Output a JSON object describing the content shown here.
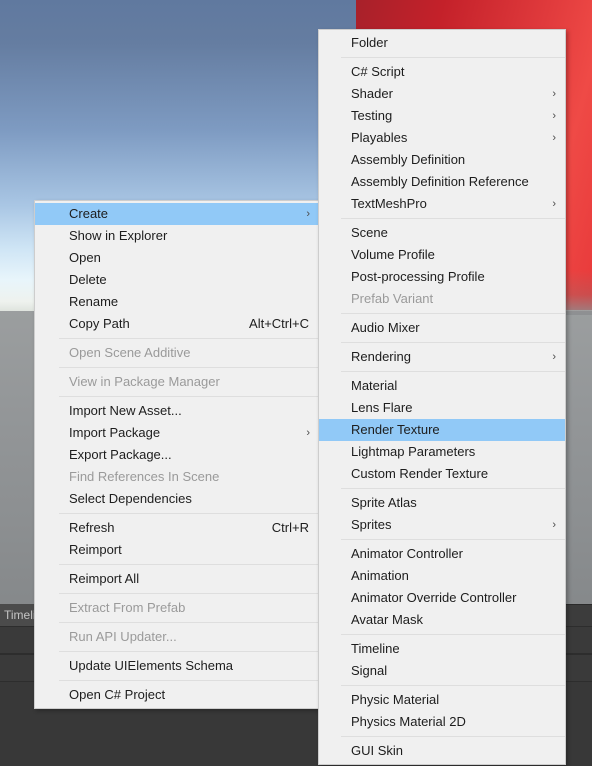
{
  "scene": {
    "sky_color_top": "#60799f",
    "sky_color_bottom": "#e8f5fb",
    "ground_color": "#939698",
    "object_color": "#e03a3c"
  },
  "editor": {
    "tab_label": "Timeline"
  },
  "context_menu": {
    "name": "project-context-menu",
    "items": [
      {
        "label": "Create",
        "selected": true,
        "submenu": true,
        "arrow": "›"
      },
      {
        "label": "Show in Explorer"
      },
      {
        "label": "Open"
      },
      {
        "label": "Delete"
      },
      {
        "label": "Rename"
      },
      {
        "label": "Copy Path",
        "shortcut": "Alt+Ctrl+C"
      },
      {
        "separator": true
      },
      {
        "label": "Open Scene Additive",
        "disabled": true
      },
      {
        "separator": true
      },
      {
        "label": "View in Package Manager",
        "disabled": true
      },
      {
        "separator": true
      },
      {
        "label": "Import New Asset..."
      },
      {
        "label": "Import Package",
        "submenu": true,
        "arrow": "›"
      },
      {
        "label": "Export Package..."
      },
      {
        "label": "Find References In Scene",
        "disabled": true
      },
      {
        "label": "Select Dependencies"
      },
      {
        "separator": true
      },
      {
        "label": "Refresh",
        "shortcut": "Ctrl+R"
      },
      {
        "label": "Reimport"
      },
      {
        "separator": true
      },
      {
        "label": "Reimport All"
      },
      {
        "separator": true
      },
      {
        "label": "Extract From Prefab",
        "disabled": true
      },
      {
        "separator": true
      },
      {
        "label": "Run API Updater...",
        "disabled": true
      },
      {
        "separator": true
      },
      {
        "label": "Update UIElements Schema"
      },
      {
        "separator": true
      },
      {
        "label": "Open C# Project"
      }
    ]
  },
  "create_submenu": {
    "name": "create-submenu",
    "items": [
      {
        "label": "Folder"
      },
      {
        "separator": true
      },
      {
        "label": "C# Script"
      },
      {
        "label": "Shader",
        "submenu": true,
        "arrow": "›"
      },
      {
        "label": "Testing",
        "submenu": true,
        "arrow": "›"
      },
      {
        "label": "Playables",
        "submenu": true,
        "arrow": "›"
      },
      {
        "label": "Assembly Definition"
      },
      {
        "label": "Assembly Definition Reference"
      },
      {
        "label": "TextMeshPro",
        "submenu": true,
        "arrow": "›"
      },
      {
        "separator": true
      },
      {
        "label": "Scene"
      },
      {
        "label": "Volume Profile"
      },
      {
        "label": "Post-processing Profile"
      },
      {
        "label": "Prefab Variant",
        "disabled": true
      },
      {
        "separator": true
      },
      {
        "label": "Audio Mixer"
      },
      {
        "separator": true
      },
      {
        "label": "Rendering",
        "submenu": true,
        "arrow": "›"
      },
      {
        "separator": true
      },
      {
        "label": "Material"
      },
      {
        "label": "Lens Flare"
      },
      {
        "label": "Render Texture",
        "selected": true
      },
      {
        "label": "Lightmap Parameters"
      },
      {
        "label": "Custom Render Texture"
      },
      {
        "separator": true
      },
      {
        "label": "Sprite Atlas"
      },
      {
        "label": "Sprites",
        "submenu": true,
        "arrow": "›"
      },
      {
        "separator": true
      },
      {
        "label": "Animator Controller"
      },
      {
        "label": "Animation"
      },
      {
        "label": "Animator Override Controller"
      },
      {
        "label": "Avatar Mask"
      },
      {
        "separator": true
      },
      {
        "label": "Timeline"
      },
      {
        "label": "Signal"
      },
      {
        "separator": true
      },
      {
        "label": "Physic Material"
      },
      {
        "label": "Physics Material 2D"
      },
      {
        "separator": true
      },
      {
        "label": "GUI Skin"
      }
    ]
  }
}
